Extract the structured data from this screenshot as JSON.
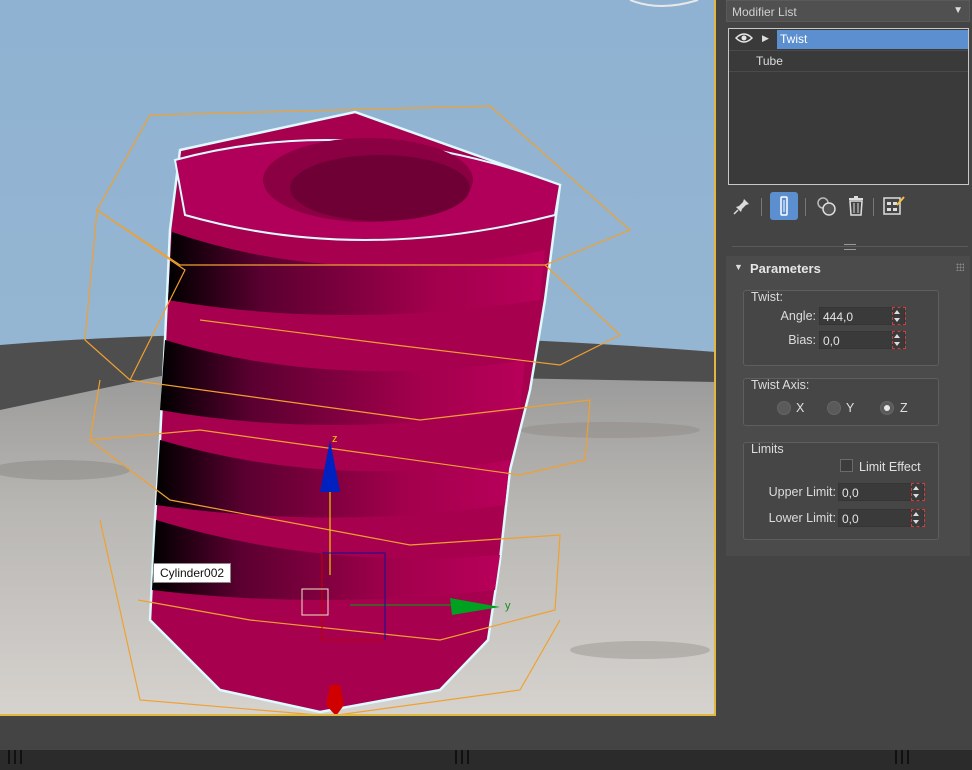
{
  "viewport": {
    "object_tooltip": "Cylinder002",
    "gizmo": {
      "z_label": "z",
      "y_label": "y"
    },
    "colors": {
      "sky": "#93b4d0",
      "object": "#a8004e",
      "selection_outline": "#dffaff",
      "cage": "#f0a030",
      "border": "#e0b840"
    }
  },
  "panel": {
    "modifier_list": {
      "label": "Modifier List"
    },
    "stack": [
      {
        "label": "Twist",
        "selected": true
      },
      {
        "label": "Tube",
        "selected": false
      }
    ],
    "toolbar_icons": [
      "pin-stack-icon",
      "show-end-result-icon",
      "make-unique-icon",
      "remove-modifier-icon",
      "configure-modifier-sets-icon"
    ],
    "parameters": {
      "title": "Parameters",
      "twist": {
        "title": "Twist:",
        "angle_label": "Angle:",
        "angle_value": "444,0",
        "bias_label": "Bias:",
        "bias_value": "0,0"
      },
      "twist_axis": {
        "title": "Twist Axis:",
        "options": [
          "X",
          "Y",
          "Z"
        ],
        "selected": "Z"
      },
      "limits": {
        "title": "Limits",
        "limit_effect_label": "Limit Effect",
        "limit_effect_checked": false,
        "upper_label": "Upper Limit:",
        "upper_value": "0,0",
        "lower_label": "Lower Limit:",
        "lower_value": "0,0"
      }
    }
  }
}
